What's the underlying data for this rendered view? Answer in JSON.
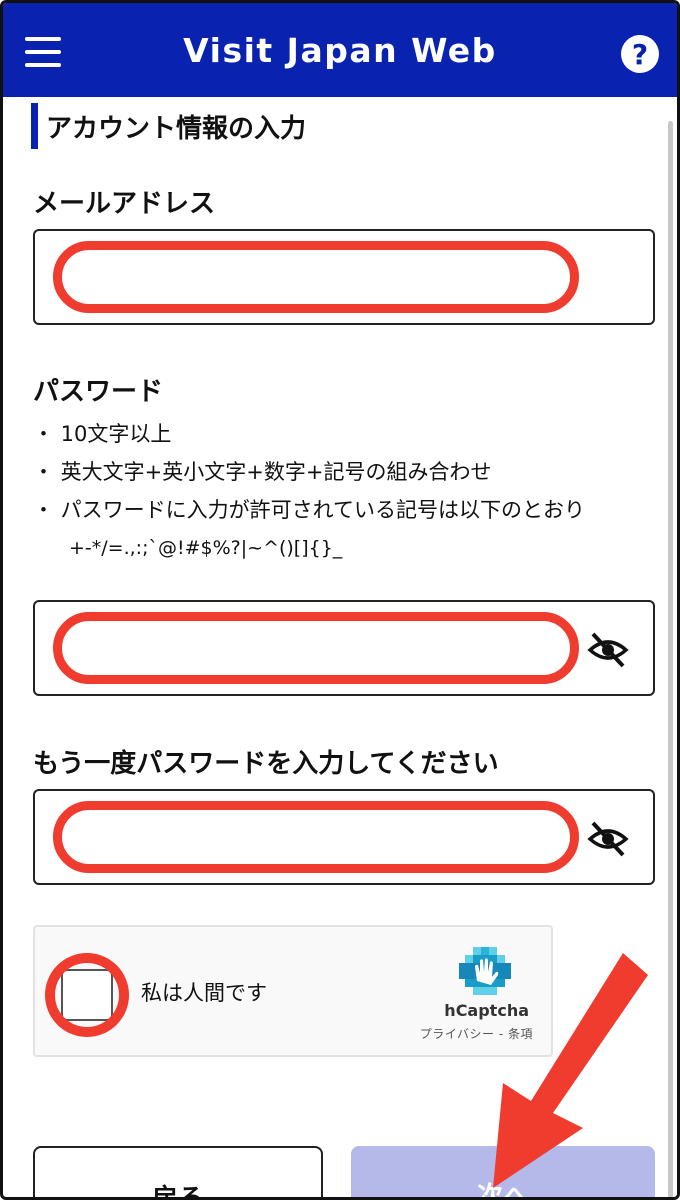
{
  "header": {
    "title": "Visit Japan Web",
    "help_label": "?"
  },
  "section": {
    "title": "アカウント情報の入力"
  },
  "email": {
    "label": "メールアドレス",
    "value": ""
  },
  "password": {
    "label": "パスワード",
    "rules": [
      "・ 10文字以上",
      "・ 英大文字+英小文字+数字+記号の組み合わせ",
      "・ パスワードに入力が許可されている記号は以下のとおり"
    ],
    "symbols": "+-*/=.,:;`@!#$%?|~^()[]{}_",
    "value": ""
  },
  "password_confirm": {
    "label": "もう一度パスワードを入力してください",
    "value": ""
  },
  "captcha": {
    "label": "私は人間です",
    "brand": "hCaptcha",
    "links": "プライバシー - 条項"
  },
  "buttons": {
    "back": "戻る",
    "next": "次へ"
  },
  "colors": {
    "header": "#0a22b0",
    "highlight": "#f03b2f",
    "next_button": "#b4b9ea"
  }
}
